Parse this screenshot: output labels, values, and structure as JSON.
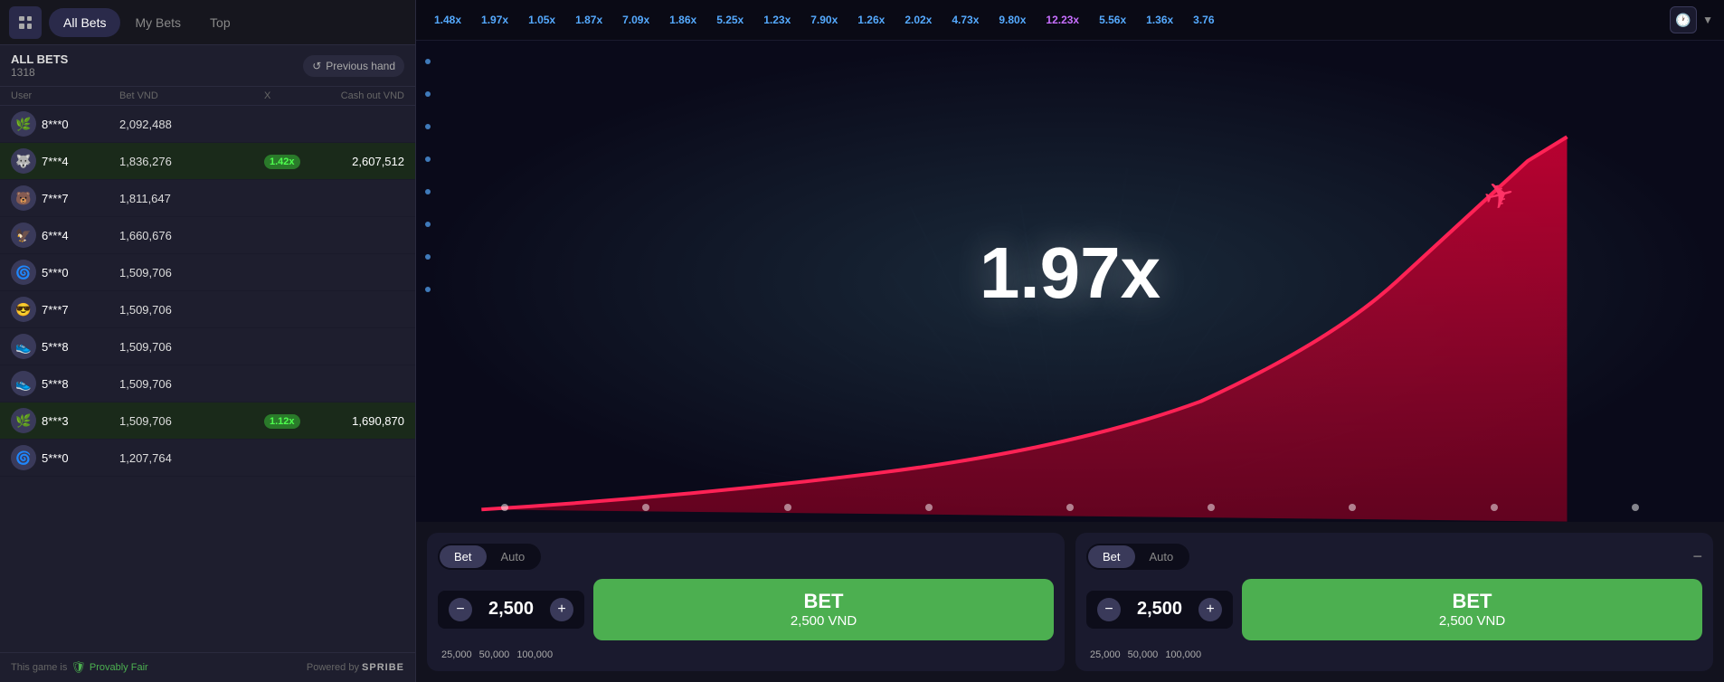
{
  "tabs": {
    "all_bets_label": "All Bets",
    "my_bets_label": "My Bets",
    "top_label": "Top"
  },
  "bets_section": {
    "title": "ALL BETS",
    "count": "1318",
    "prev_hand_label": "Previous hand",
    "columns": {
      "user": "User",
      "bet": "Bet VND",
      "x": "X",
      "cashout": "Cash out VND"
    }
  },
  "bets": [
    {
      "avatar": "🌿",
      "user": "8***0",
      "bet": "2,092,488",
      "multiplier": "",
      "cashout": ""
    },
    {
      "avatar": "🐺",
      "user": "7***4",
      "bet": "1,836,276",
      "multiplier": "1.42x",
      "cashout": "2,607,512",
      "cashed": true
    },
    {
      "avatar": "🐻",
      "user": "7***7",
      "bet": "1,811,647",
      "multiplier": "",
      "cashout": ""
    },
    {
      "avatar": "🦅",
      "user": "6***4",
      "bet": "1,660,676",
      "multiplier": "",
      "cashout": ""
    },
    {
      "avatar": "🌀",
      "user": "5***0",
      "bet": "1,509,706",
      "multiplier": "",
      "cashout": ""
    },
    {
      "avatar": "😎",
      "user": "7***7",
      "bet": "1,509,706",
      "multiplier": "",
      "cashout": ""
    },
    {
      "avatar": "👟",
      "user": "5***8",
      "bet": "1,509,706",
      "multiplier": "",
      "cashout": ""
    },
    {
      "avatar": "👟",
      "user": "5***8",
      "bet": "1,509,706",
      "multiplier": "",
      "cashout": ""
    },
    {
      "avatar": "🌿",
      "user": "8***3",
      "bet": "1,509,706",
      "multiplier": "1.12x",
      "cashout": "1,690,870",
      "cashed": true
    },
    {
      "avatar": "🌀",
      "user": "5***0",
      "bet": "1,207,764",
      "multiplier": "",
      "cashout": ""
    }
  ],
  "footer": {
    "provably_fair_label": "This game is",
    "provably_fair_link": "Provably Fair",
    "powered_by": "Powered by",
    "brand": "SPRIBE"
  },
  "multipliers_bar": [
    {
      "value": "1.48x",
      "color": "blue"
    },
    {
      "value": "1.97x",
      "color": "blue"
    },
    {
      "value": "1.05x",
      "color": "blue"
    },
    {
      "value": "1.87x",
      "color": "blue"
    },
    {
      "value": "7.09x",
      "color": "blue"
    },
    {
      "value": "1.86x",
      "color": "blue"
    },
    {
      "value": "5.25x",
      "color": "blue"
    },
    {
      "value": "1.23x",
      "color": "blue"
    },
    {
      "value": "7.90x",
      "color": "blue"
    },
    {
      "value": "1.26x",
      "color": "blue"
    },
    {
      "value": "2.02x",
      "color": "blue"
    },
    {
      "value": "4.73x",
      "color": "blue"
    },
    {
      "value": "9.80x",
      "color": "blue"
    },
    {
      "value": "12.23x",
      "color": "purple"
    },
    {
      "value": "5.56x",
      "color": "blue"
    },
    {
      "value": "1.36x",
      "color": "blue"
    },
    {
      "value": "3.76",
      "color": "blue"
    }
  ],
  "game": {
    "current_multiplier": "1.97x"
  },
  "bet_panels": [
    {
      "id": "panel1",
      "tabs": [
        "Bet",
        "Auto"
      ],
      "active_tab": "Bet",
      "amount": "2,500",
      "quick_amounts": [
        "25,000",
        "50,000",
        "100,000"
      ],
      "button_label": "BET",
      "button_sublabel": "2,500 VND"
    },
    {
      "id": "panel2",
      "tabs": [
        "Bet",
        "Auto"
      ],
      "active_tab": "Bet",
      "amount": "2,500",
      "quick_amounts": [
        "25,000",
        "50,000",
        "100,000"
      ],
      "button_label": "BET",
      "button_sublabel": "2,500 VND"
    }
  ]
}
